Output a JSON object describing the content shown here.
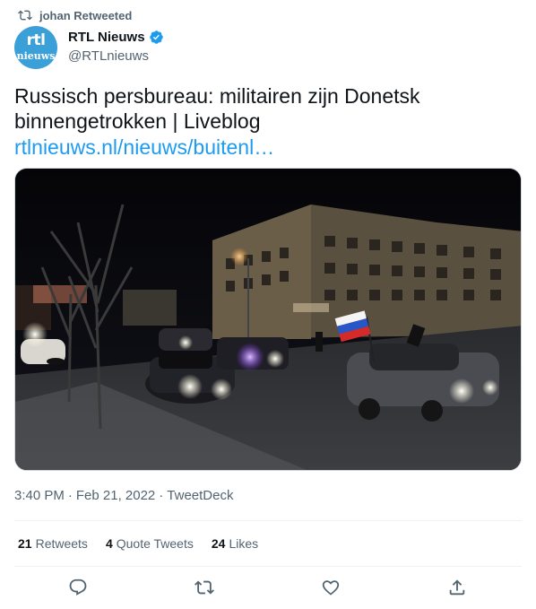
{
  "retweet_context": {
    "text": "johan Retweeted"
  },
  "author": {
    "name": "RTL Nieuws",
    "handle": "@RTLnieuws",
    "avatar_text_top": "rtl",
    "avatar_text_bottom": "nieuws",
    "avatar_color": "#3b9fd8",
    "verified": true
  },
  "tweet": {
    "text": "Russisch persbureau: militairen zijn Donetsk binnengetrokken | Liveblog",
    "link": "rtlnieuws.nl/nieuws/buitenl…"
  },
  "meta": {
    "time": "3:40 PM",
    "date": "Feb 21, 2022",
    "source": "TweetDeck",
    "sep": "·"
  },
  "stats": {
    "retweets_count": "21",
    "retweets_label": "Retweets",
    "quotes_count": "4",
    "quotes_label": "Quote Tweets",
    "likes_count": "24",
    "likes_label": "Likes"
  },
  "actions": [
    "reply-icon",
    "retweet-icon",
    "like-icon",
    "share-icon"
  ],
  "colors": {
    "link": "#1d9bf0",
    "secondary_text": "#536471",
    "verified": "#1d9bf0"
  }
}
